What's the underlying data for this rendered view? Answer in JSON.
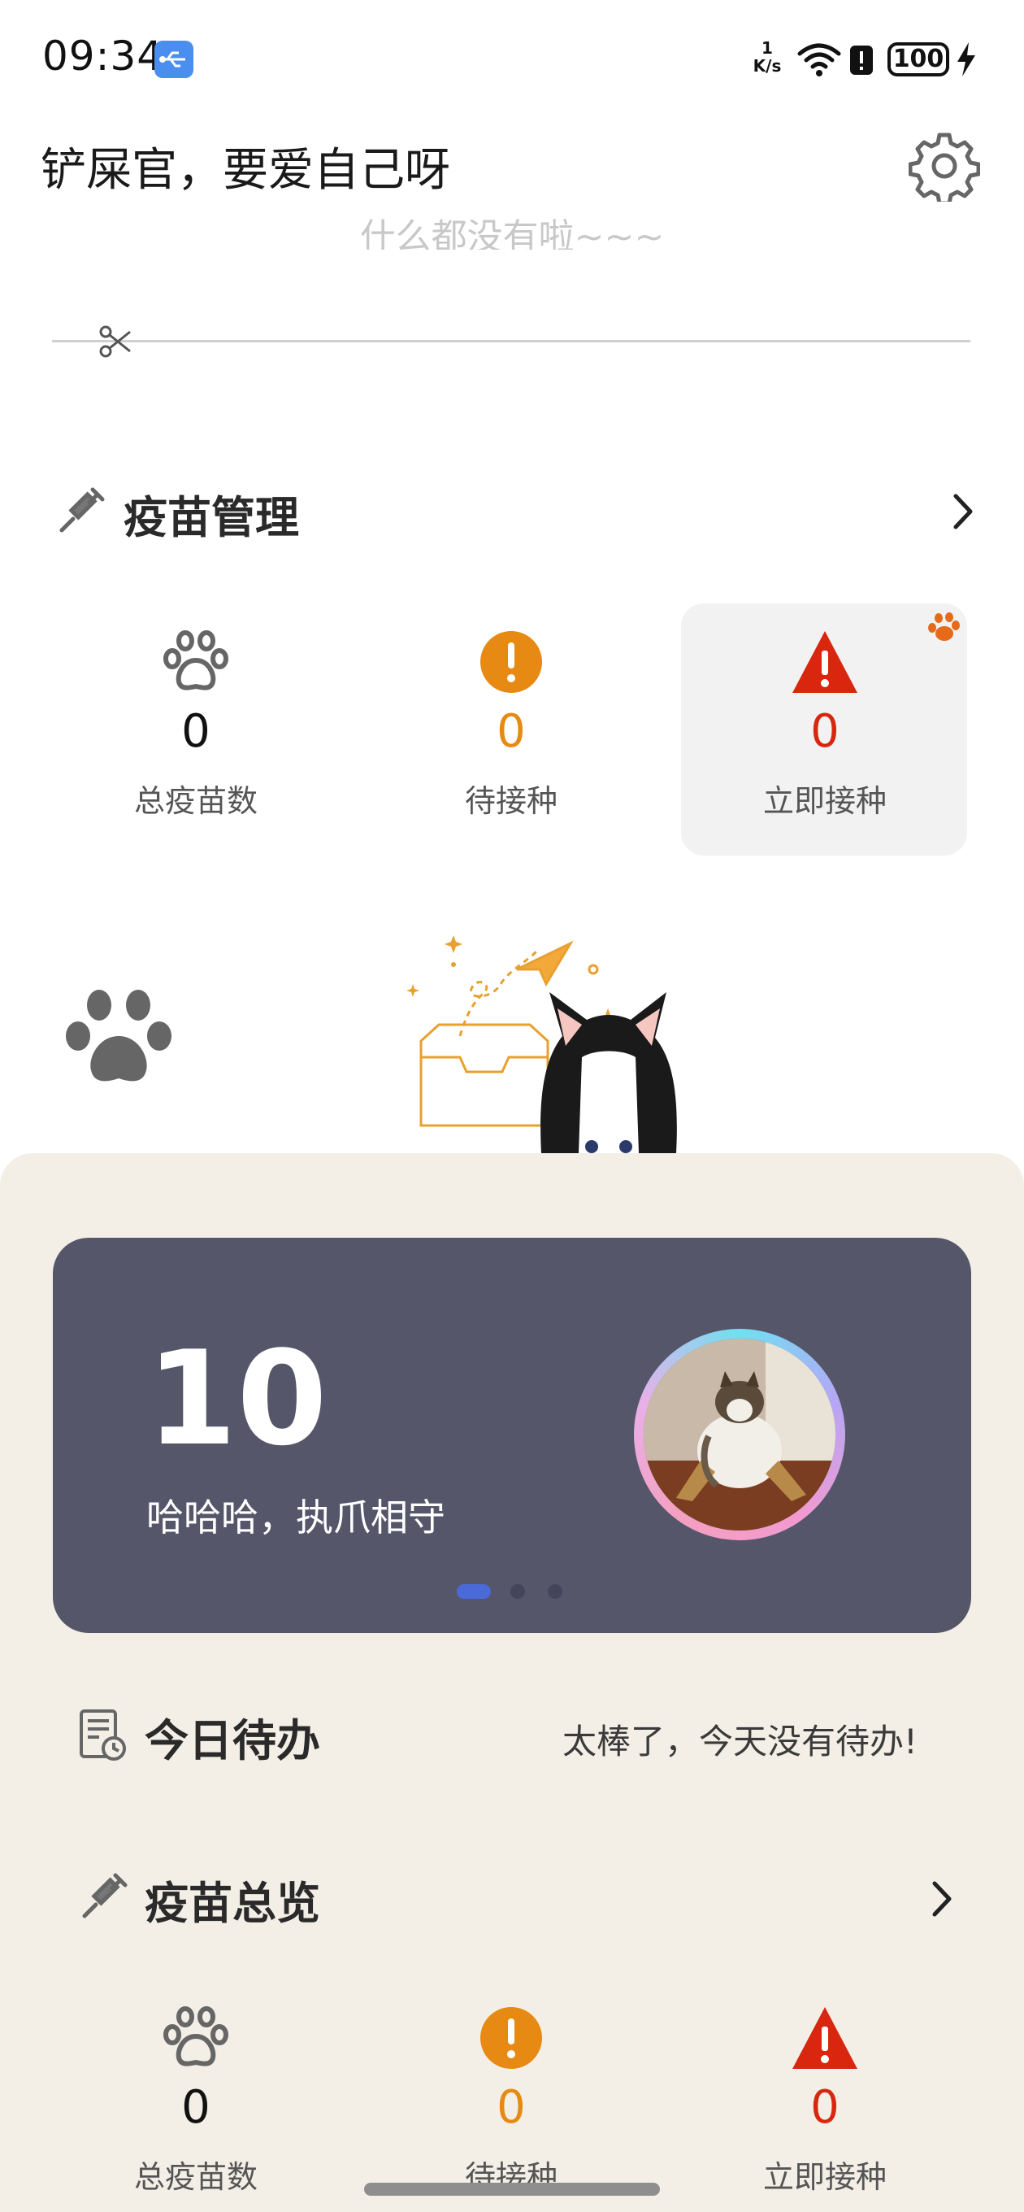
{
  "status_bar": {
    "time": "09:34",
    "net_speed_value": "1",
    "net_speed_unit": "K/s",
    "battery": "100"
  },
  "header": {
    "greeting": "铲屎官，要爱自己呀",
    "settings_icon": "gear-icon"
  },
  "notice": {
    "empty_message": "什么都没有啦~~~"
  },
  "vaccine_management": {
    "title": "疫苗管理",
    "stats": [
      {
        "value": "0",
        "label": "总疫苗数",
        "icon": "paw-icon"
      },
      {
        "value": "0",
        "label": "待接种",
        "icon": "exclamation-circle-icon",
        "color": "#e78a13"
      },
      {
        "value": "0",
        "label": "立即接种",
        "icon": "warning-triangle-icon",
        "color": "#d9260f"
      }
    ]
  },
  "banner": {
    "days": "10",
    "text": "哈哈哈，执爪相守",
    "page_count": 3,
    "active_page": 1
  },
  "today_todo": {
    "title": "今日待办",
    "message": "太棒了，今天没有待办!"
  },
  "vaccine_overview": {
    "title": "疫苗总览",
    "stats": [
      {
        "value": "0",
        "label": "总疫苗数"
      },
      {
        "value": "0",
        "label": "待接种"
      },
      {
        "value": "0",
        "label": "立即接种"
      }
    ]
  },
  "colors": {
    "accent_orange": "#e78a13",
    "alert_red": "#d9260f",
    "sheet_background": "#f3efe6",
    "banner_background": "#55566a"
  }
}
